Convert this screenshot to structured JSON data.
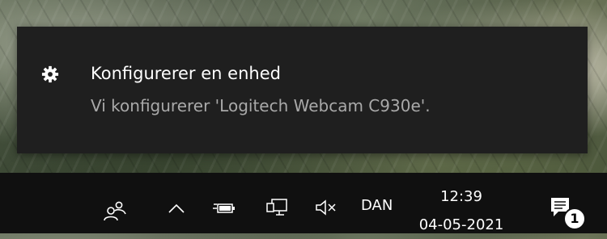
{
  "notification": {
    "title": "Konfigurerer en enhed",
    "message": "Vi konfigurerer 'Logitech Webcam C930e'.",
    "icon": "gear-icon"
  },
  "taskbar": {
    "icons": [
      "people-icon",
      "chevron-up-icon",
      "battery-icon",
      "network-icon",
      "volume-muted-icon",
      "action-center-icon"
    ],
    "language": "DAN",
    "time": "12:39",
    "date": "04-05-2021",
    "notification_count": "1"
  },
  "colors": {
    "toast_bg": "#1f1f1f",
    "taskbar_bg": "#101010",
    "title_text": "#ffffff",
    "message_text": "#a9a9a9"
  }
}
